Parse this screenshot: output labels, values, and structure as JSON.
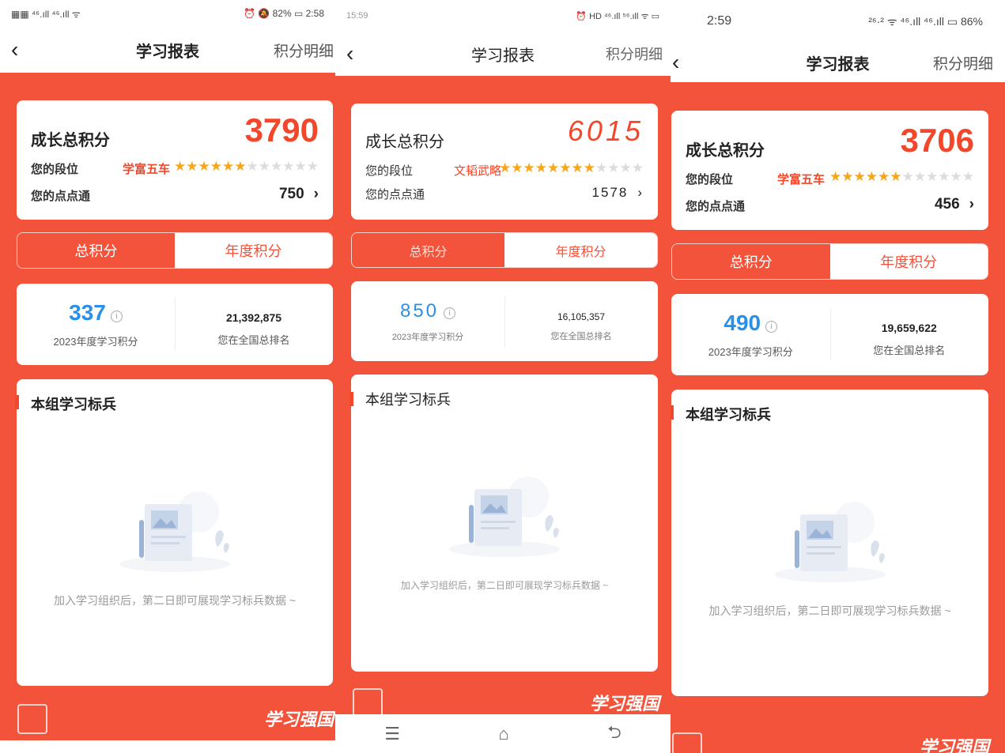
{
  "panels": [
    {
      "status": {
        "left": "▦▦ ⁴⁶.ıll ⁴⁶.ıll ᯤ",
        "right": "⏰ 🔕 82% ▭ 2:58"
      },
      "nav": {
        "title": "学习报表",
        "right": "积分明细"
      },
      "summary": {
        "title": "成长总积分",
        "score": "3790",
        "rank_label": "您的段位",
        "rank_name": "学富五车",
        "stars_on": 6,
        "stars_total": 12,
        "points_label": "您的点点通",
        "points": "750"
      },
      "tabs": {
        "total": "总积分",
        "annual": "年度积分"
      },
      "stats": {
        "annual_points": "337",
        "annual_caption": "2023年度学习积分",
        "national_rank": "21,392,875",
        "rank_caption": "您在全国总排名"
      },
      "group": {
        "title": "本组学习标兵",
        "empty": "加入学习组织后，第二日即可展现学习标兵数据 ~"
      },
      "footer": {
        "logo": "学习强国"
      }
    },
    {
      "status": {
        "left": "15:59",
        "right": "⏰ HD ⁴⁶.ıll ⁵⁶.ıll ᯤ ▭"
      },
      "nav": {
        "title": "学习报表",
        "right": "积分明细"
      },
      "summary": {
        "title": "成长总积分",
        "score": "6015",
        "rank_label": "您的段位",
        "rank_name": "文韬武略",
        "stars_on": 8,
        "stars_total": 12,
        "points_label": "您的点点通",
        "points": "1578"
      },
      "tabs": {
        "total": "总积分",
        "annual": "年度积分"
      },
      "stats": {
        "annual_points": "850",
        "annual_caption": "2023年度学习积分",
        "national_rank": "16,105,357",
        "rank_caption": "您在全国总排名"
      },
      "group": {
        "title": "本组学习标兵",
        "empty": "加入学习组织后，第二日即可展现学习标兵数据 ~"
      },
      "footer": {
        "logo": "学习强国"
      },
      "bottom_nav": {
        "menu": "☰",
        "home": "⌂",
        "back": "⮌"
      }
    },
    {
      "status": {
        "left": "2:59",
        "right": "²⁶·² ᯤ ⁴⁶.ıll ⁴⁶.ıll ▭ 86%"
      },
      "nav": {
        "title": "学习报表",
        "right": "积分明细"
      },
      "summary": {
        "title": "成长总积分",
        "score": "3706",
        "rank_label": "您的段位",
        "rank_name": "学富五车",
        "stars_on": 6,
        "stars_total": 12,
        "points_label": "您的点点通",
        "points": "456"
      },
      "tabs": {
        "total": "总积分",
        "annual": "年度积分"
      },
      "stats": {
        "annual_points": "490",
        "annual_caption": "2023年度学习积分",
        "national_rank": "19,659,622",
        "rank_caption": "您在全国总排名"
      },
      "group": {
        "title": "本组学习标兵",
        "empty": "加入学习组织后，第二日即可展现学习标兵数据 ~"
      },
      "footer": {
        "logo": "学习强国"
      }
    }
  ],
  "colors": {
    "accent": "#f3533a",
    "score": "#f2472a",
    "annual_points": "#2a8fe6",
    "star_on": "#f8a51a",
    "star_off": "#dcdcdc"
  }
}
